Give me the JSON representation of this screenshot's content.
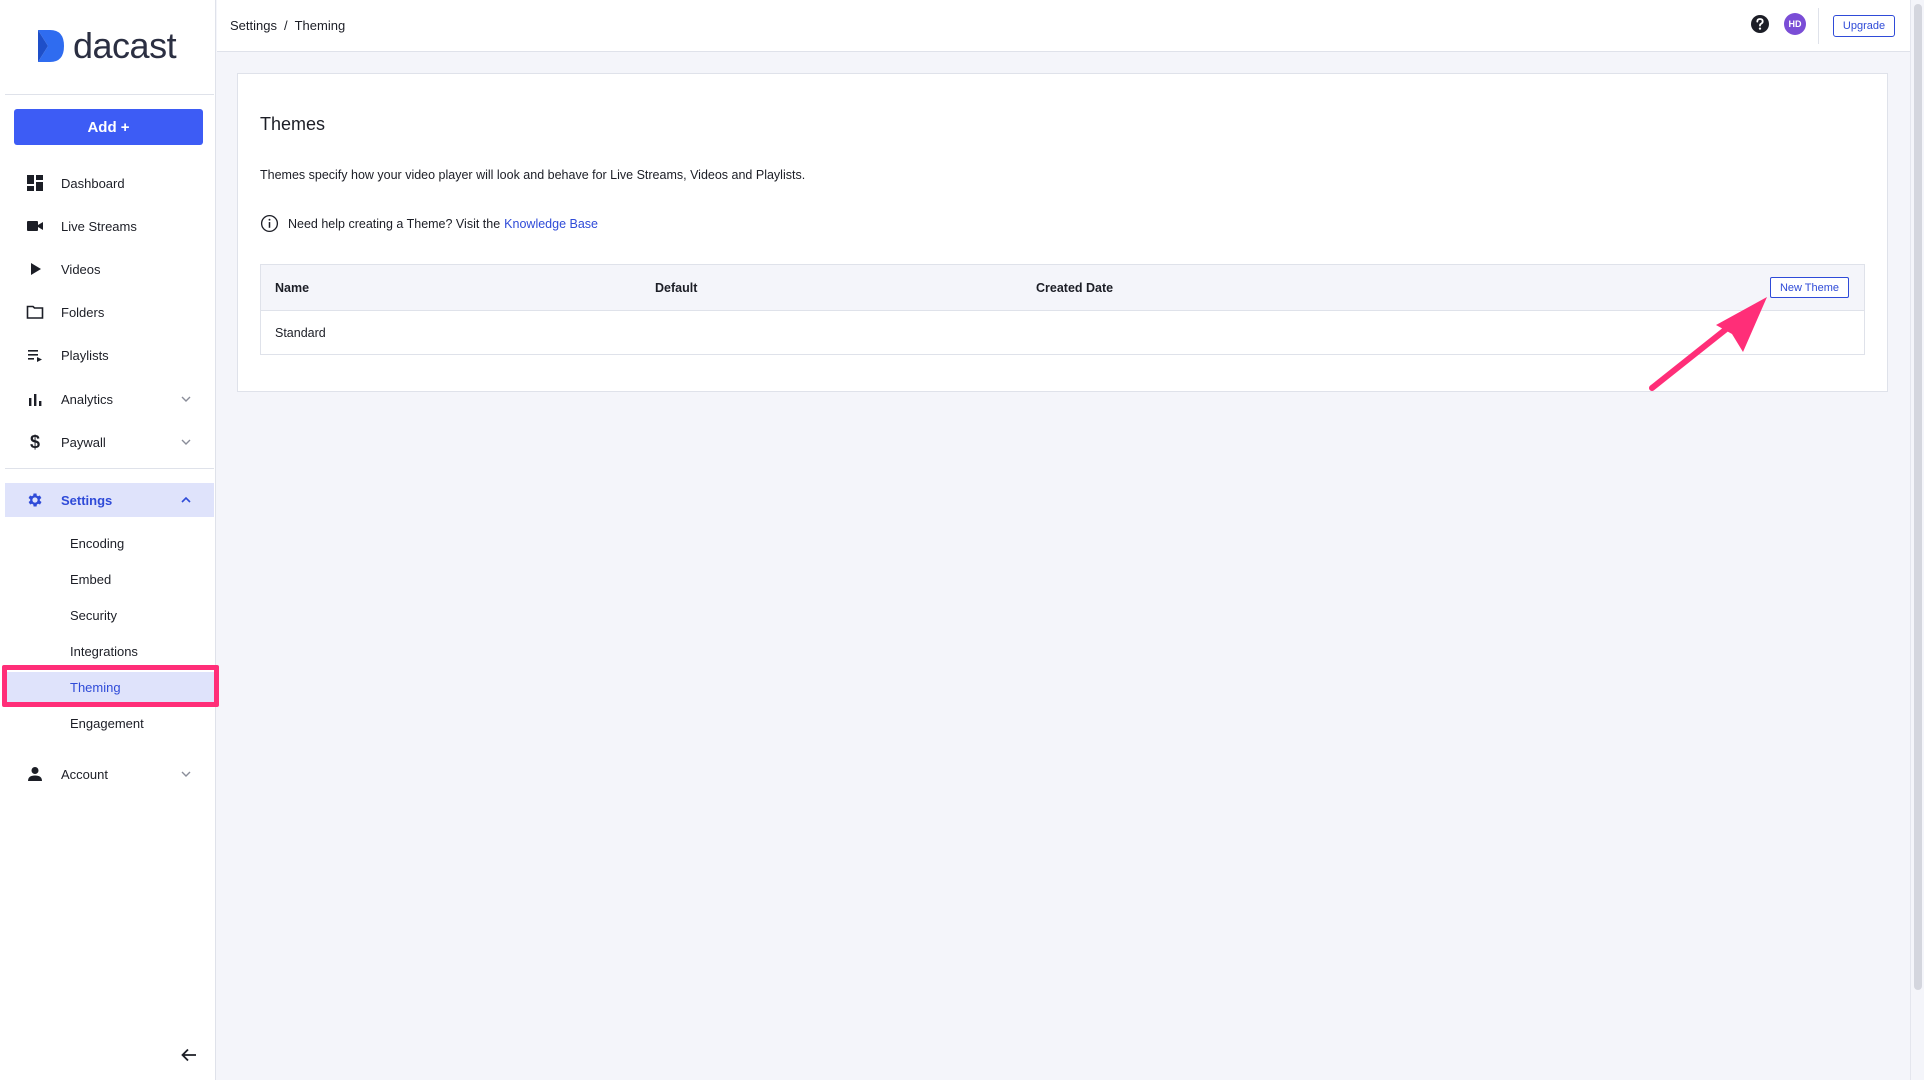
{
  "brand": {
    "name": "dacast",
    "accent_color": "#3d5cf5",
    "highlight_color": "#ff2e78"
  },
  "sidebar": {
    "add_button": "Add +",
    "items": [
      {
        "label": "Dashboard",
        "icon": "dashboard-icon"
      },
      {
        "label": "Live Streams",
        "icon": "video-camera-icon"
      },
      {
        "label": "Videos",
        "icon": "play-icon"
      },
      {
        "label": "Folders",
        "icon": "folder-icon"
      },
      {
        "label": "Playlists",
        "icon": "playlist-icon"
      },
      {
        "label": "Analytics",
        "icon": "bar-chart-icon"
      },
      {
        "label": "Paywall",
        "icon": "dollar-icon"
      },
      {
        "label": "Settings",
        "icon": "gear-icon",
        "expanded": true
      },
      {
        "label": "Account",
        "icon": "person-icon"
      }
    ],
    "settings_subitems": [
      {
        "label": "Encoding"
      },
      {
        "label": "Embed"
      },
      {
        "label": "Security"
      },
      {
        "label": "Integrations"
      },
      {
        "label": "Theming",
        "active": true
      },
      {
        "label": "Engagement"
      }
    ]
  },
  "header": {
    "breadcrumb": [
      "Settings",
      "/",
      "Theming"
    ],
    "avatar_initials": "HD",
    "upgrade_label": "Upgrade"
  },
  "themes": {
    "title": "Themes",
    "description": "Themes specify how your video player will look and behave for Live Streams, Videos and Playlists.",
    "help_text": "Need help creating a Theme? Visit the",
    "help_link": "Knowledge Base",
    "table": {
      "columns": [
        "Name",
        "Default",
        "Created Date"
      ],
      "new_theme_label": "New Theme",
      "rows": [
        {
          "name": "Standard",
          "default": "",
          "created": ""
        }
      ]
    }
  }
}
